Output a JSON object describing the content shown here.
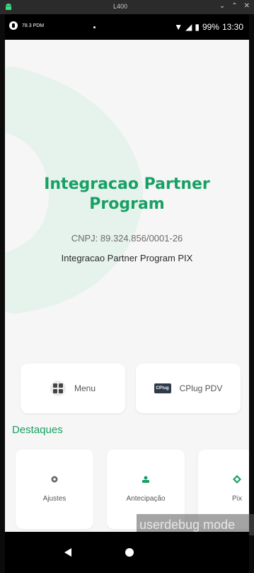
{
  "window": {
    "title": "L400"
  },
  "statusbar": {
    "left_text": "78.3 PDM",
    "battery": "99%",
    "time": "13:30"
  },
  "app": {
    "title": "Integracao Partner Program",
    "cnpj": "CNPJ: 89.324.856/0001-26",
    "subtitle": "Integracao Partner Program PIX",
    "accent_color": "#17a063"
  },
  "quick_actions": [
    {
      "label": "Menu",
      "icon": "grid-icon"
    },
    {
      "label": "CPlug PDV",
      "icon": "cplug-logo"
    }
  ],
  "cplug_logo_text": "CPlug",
  "highlights": {
    "title": "Destaques",
    "items": [
      {
        "label": "Ajustes",
        "icon": "gear-icon"
      },
      {
        "label": "Antecipação",
        "icon": "money-icon"
      },
      {
        "label": "Pix",
        "icon": "pix-icon"
      }
    ]
  },
  "debug_banner": "userdebug mode"
}
